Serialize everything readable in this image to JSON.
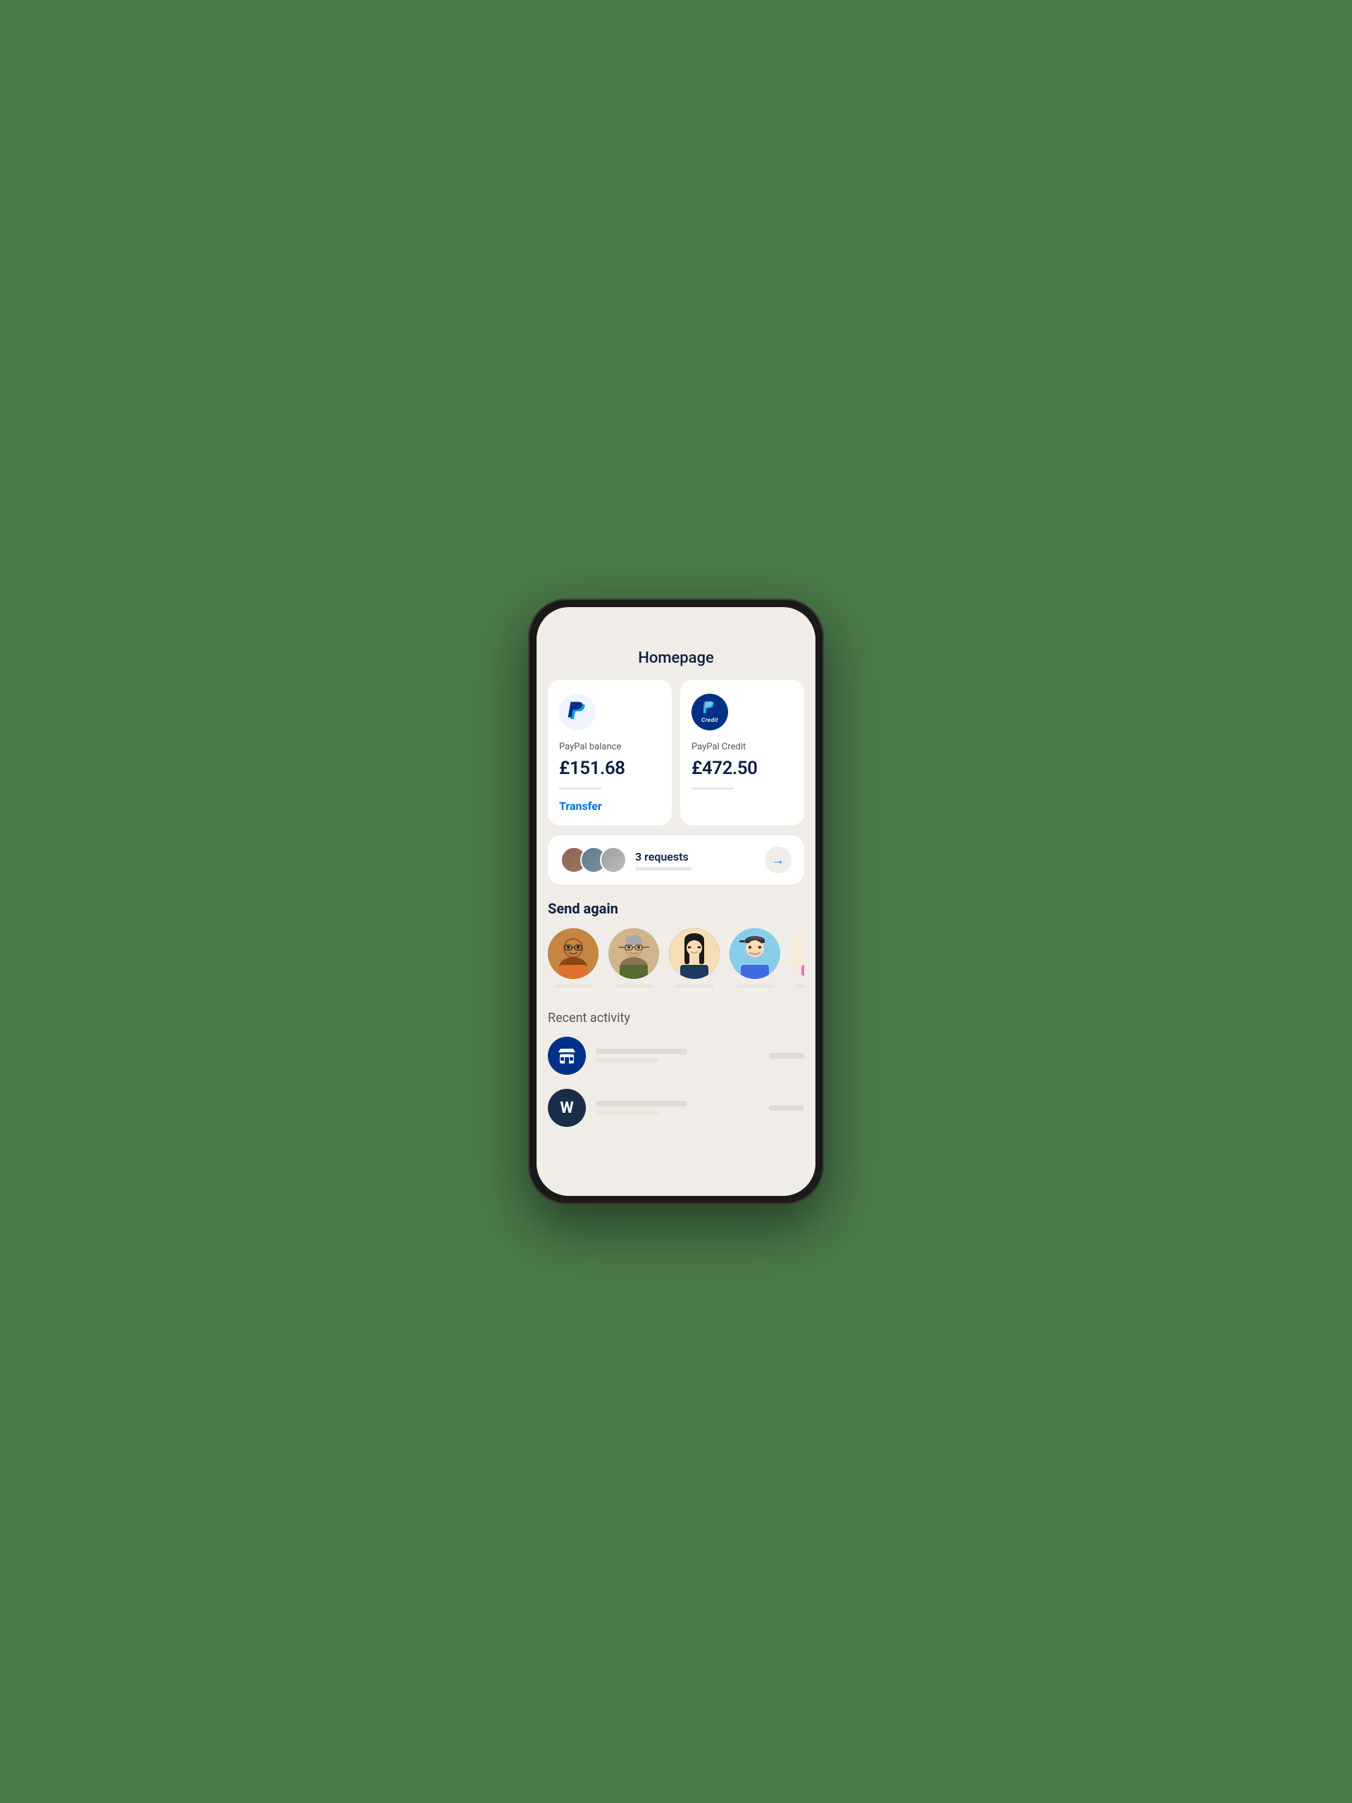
{
  "page": {
    "title": "Homepage",
    "background_color": "#4a7a4a"
  },
  "balance_cards": [
    {
      "id": "paypal-balance",
      "logo_type": "light",
      "label": "PayPal balance",
      "amount": "£151.68",
      "action_label": "Transfer"
    },
    {
      "id": "paypal-credit",
      "logo_type": "dark",
      "label": "PayPal Credit",
      "amount": "£472.50",
      "credit_text": "Credit"
    }
  ],
  "requests": {
    "count": "3 requests",
    "avatar_colors": [
      "#8B6355",
      "#607D8B",
      "#9E9E9E"
    ]
  },
  "send_again": {
    "title": "Send again",
    "people": [
      {
        "id": "p1",
        "color_class": "p1"
      },
      {
        "id": "p2",
        "color_class": "p2"
      },
      {
        "id": "p3",
        "color_class": "p3"
      },
      {
        "id": "p4",
        "color_class": "p4"
      },
      {
        "id": "p5",
        "color_class": "p5"
      }
    ]
  },
  "recent_activity": {
    "title": "Recent activity",
    "items": [
      {
        "id": "act1",
        "icon_type": "store",
        "bg": "blue"
      },
      {
        "id": "act2",
        "icon_type": "initial",
        "initial": "W",
        "bg": "dark"
      }
    ]
  }
}
